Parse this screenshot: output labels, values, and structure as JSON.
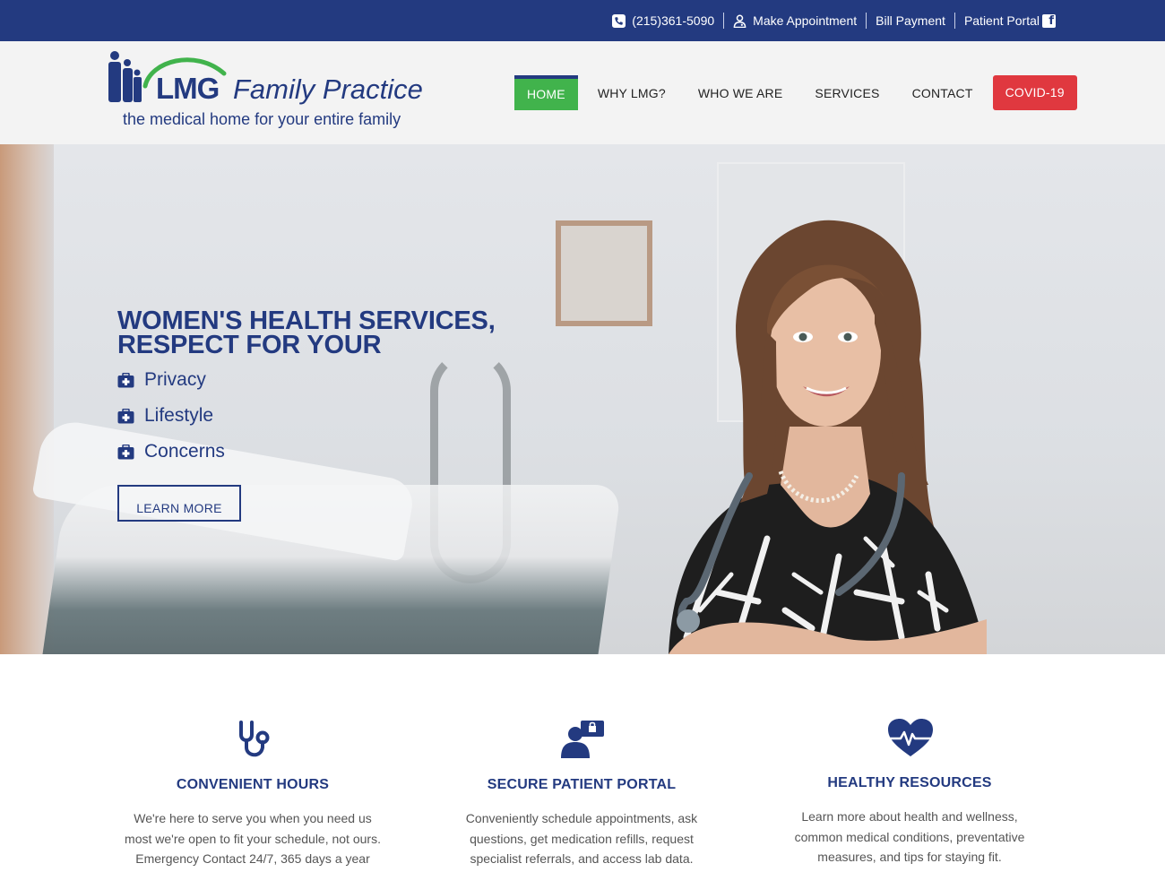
{
  "topbar": {
    "phone": "(215)361-5090",
    "appointment": "Make Appointment",
    "bill_payment": "Bill Payment",
    "patient_portal": "Patient Portal",
    "icons": [
      "phone-icon",
      "doctor-icon",
      "facebook-icon"
    ]
  },
  "logo": {
    "name": "LMG",
    "suffix": "Family Practice",
    "tagline": "the medical home for your entire family"
  },
  "nav": {
    "items": [
      "HOME",
      "WHY LMG?",
      "WHO WE ARE",
      "SERVICES",
      "CONTACT",
      "COVID-19"
    ],
    "active": "HOME"
  },
  "hero": {
    "title_line1": "WOMEN'S HEALTH SERVICES,",
    "title_line2": "RESPECT FOR YOUR",
    "items": [
      "Privacy",
      "Lifestyle",
      "Concerns"
    ],
    "button": "LEARN MORE"
  },
  "features": [
    {
      "icon": "stethoscope-icon",
      "title": "CONVENIENT HOURS",
      "text_lines": [
        "We're here to serve you when you need us",
        "most we're open to fit your schedule, not ours.",
        "Emergency Contact 24/7, 365 days a year"
      ]
    },
    {
      "icon": "patient-portal-icon",
      "title": "SECURE PATIENT PORTAL",
      "text_lines": [
        "Conveniently schedule appointments, ask",
        "questions, get medication refills, request",
        "specialist referrals, and access lab data."
      ]
    },
    {
      "icon": "heartbeat-icon",
      "title": "HEALTHY RESOURCES",
      "text_lines": [
        "Learn more about health and wellness,",
        "common medical conditions, preventative",
        "measures, and tips for staying fit."
      ]
    }
  ],
  "colors": {
    "brand_blue": "#233a80",
    "nav_active": "#41b34c",
    "covid": "#e0383f"
  }
}
